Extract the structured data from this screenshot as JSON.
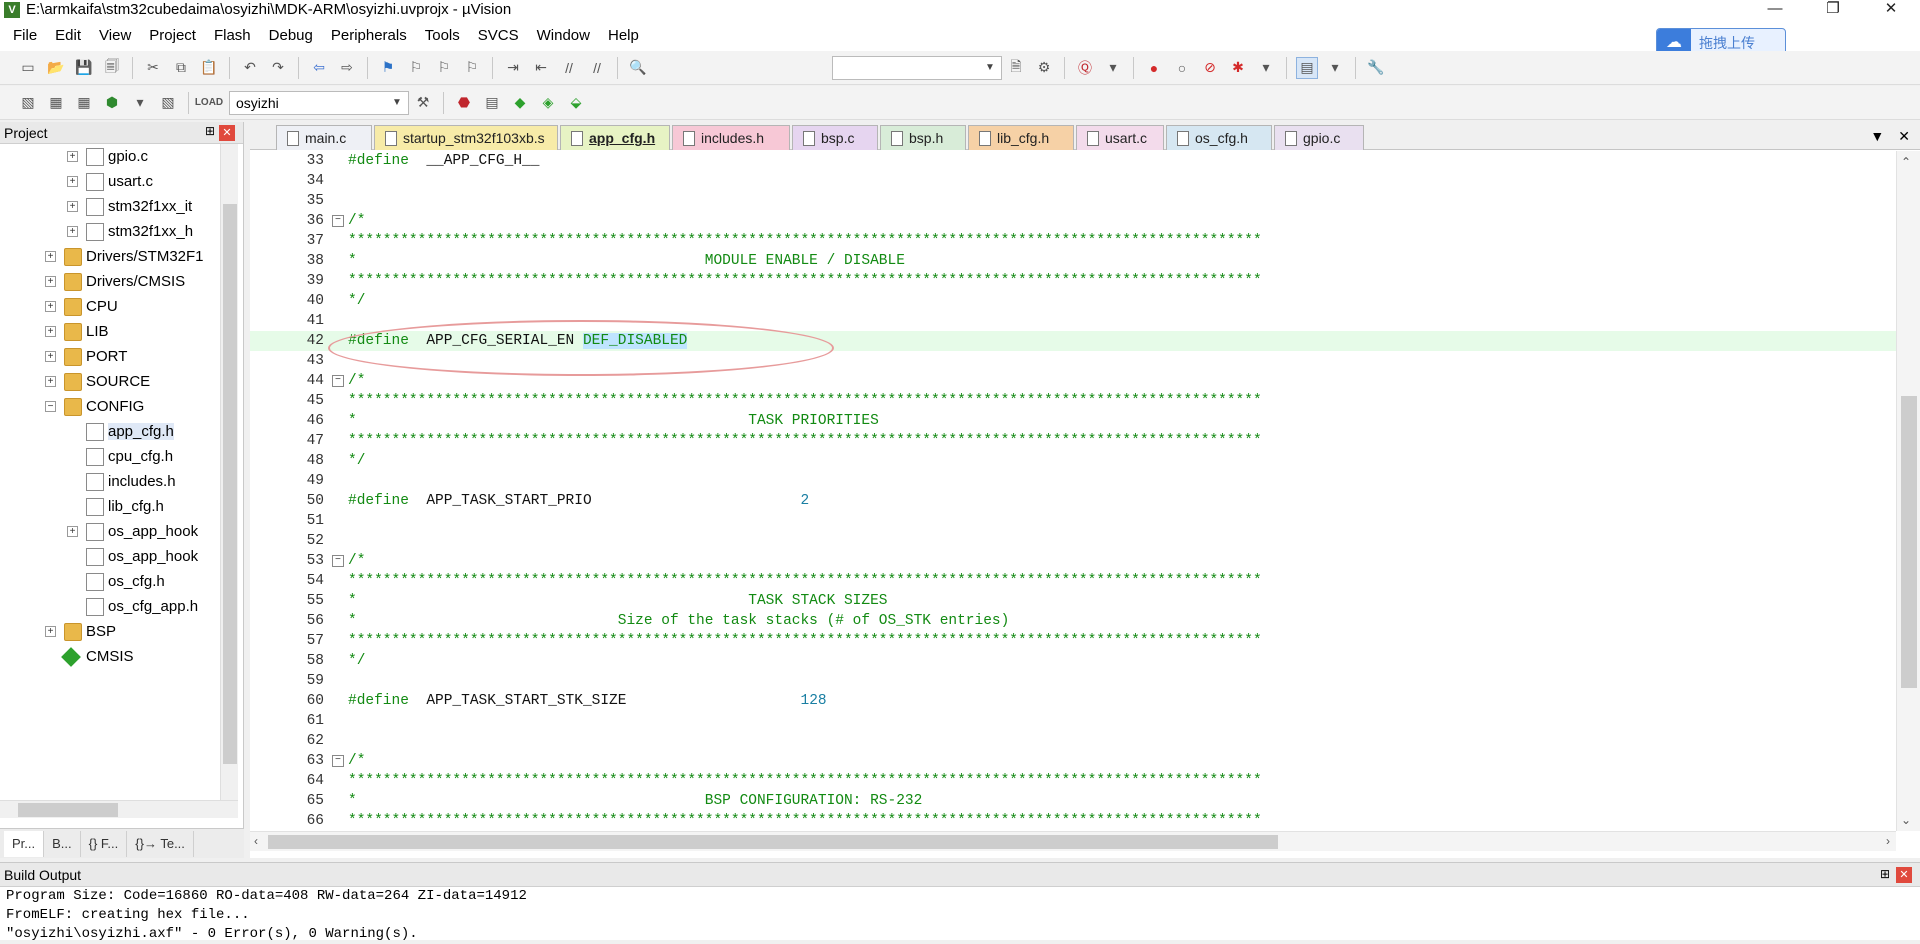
{
  "window": {
    "title": "E:\\armkaifa\\stm32cubedaima\\osyizhi\\MDK-ARM\\osyizhi.uvprojx - µVision",
    "icon_label": "V",
    "minimize": "—",
    "restore": "❐",
    "close": "✕"
  },
  "menu": [
    "File",
    "Edit",
    "View",
    "Project",
    "Flash",
    "Debug",
    "Peripherals",
    "Tools",
    "SVCS",
    "Window",
    "Help"
  ],
  "cloud_badge": {
    "label": "拖拽上传",
    "icon": "cloud-icon"
  },
  "toolbar2": {
    "target_combo": "osyizhi"
  },
  "project_panel": {
    "title": "Project",
    "pin": "⊞",
    "close": "✕",
    "tree": [
      {
        "label": "gpio.c",
        "type": "file",
        "level": 3,
        "expander": "+"
      },
      {
        "label": "usart.c",
        "type": "file",
        "level": 3,
        "expander": "+"
      },
      {
        "label": "stm32f1xx_it",
        "type": "file",
        "level": 3,
        "expander": "+"
      },
      {
        "label": "stm32f1xx_h",
        "type": "file",
        "level": 3,
        "expander": "+"
      },
      {
        "label": "Drivers/STM32F1",
        "type": "folder",
        "level": 2,
        "expander": "+"
      },
      {
        "label": "Drivers/CMSIS",
        "type": "folder",
        "level": 2,
        "expander": "+"
      },
      {
        "label": "CPU",
        "type": "folder",
        "level": 2,
        "expander": "+"
      },
      {
        "label": "LIB",
        "type": "folder",
        "level": 2,
        "expander": "+"
      },
      {
        "label": "PORT",
        "type": "folder",
        "level": 2,
        "expander": "+"
      },
      {
        "label": "SOURCE",
        "type": "folder",
        "level": 2,
        "expander": "+"
      },
      {
        "label": "CONFIG",
        "type": "folder-open",
        "level": 2,
        "expander": "−"
      },
      {
        "label": "app_cfg.h",
        "type": "file",
        "level": 3,
        "expander": "",
        "selected": true
      },
      {
        "label": "cpu_cfg.h",
        "type": "file",
        "level": 3,
        "expander": ""
      },
      {
        "label": "includes.h",
        "type": "file",
        "level": 3,
        "expander": ""
      },
      {
        "label": "lib_cfg.h",
        "type": "file",
        "level": 3,
        "expander": ""
      },
      {
        "label": "os_app_hook",
        "type": "file",
        "level": 3,
        "expander": "+"
      },
      {
        "label": "os_app_hook",
        "type": "file",
        "level": 3,
        "expander": ""
      },
      {
        "label": "os_cfg.h",
        "type": "file",
        "level": 3,
        "expander": ""
      },
      {
        "label": "os_cfg_app.h",
        "type": "file",
        "level": 3,
        "expander": ""
      },
      {
        "label": "BSP",
        "type": "folder",
        "level": 2,
        "expander": "+"
      },
      {
        "label": "CMSIS",
        "type": "diamond",
        "level": 2,
        "expander": ""
      }
    ],
    "bottom_tabs": [
      "Pr...",
      "B...",
      "{} F...",
      "{}→ Te..."
    ]
  },
  "editor": {
    "tabs": [
      {
        "label": "main.c",
        "color": "#eef0f5",
        "width": 96
      },
      {
        "label": "startup_stm32f103xb.s",
        "color": "#f7eba8",
        "width": 184
      },
      {
        "label": "app_cfg.h",
        "color": "#e7f3c4",
        "width": 110,
        "active": true
      },
      {
        "label": "includes.h",
        "color": "#f7c8d6",
        "width": 118
      },
      {
        "label": "bsp.c",
        "color": "#e6d5f0",
        "width": 86
      },
      {
        "label": "bsp.h",
        "color": "#d8ecd8",
        "width": 86
      },
      {
        "label": "lib_cfg.h",
        "color": "#f6d1a6",
        "width": 106
      },
      {
        "label": "usart.c",
        "color": "#f3dbeb",
        "width": 88
      },
      {
        "label": "os_cfg.h",
        "color": "#d6e7f2",
        "width": 106
      },
      {
        "label": "gpio.c",
        "color": "#e9e0f0",
        "width": 90
      }
    ],
    "tab_menu": "▼",
    "tab_close": "✕",
    "lines": [
      {
        "n": "33",
        "fold": "",
        "kw": "#define",
        "id": "  __APP_CFG_H__",
        "num": "",
        "rest": ""
      },
      {
        "n": "34",
        "fold": "",
        "kw": "",
        "id": "",
        "num": "",
        "rest": ""
      },
      {
        "n": "35",
        "fold": "",
        "kw": "",
        "id": "",
        "num": "",
        "rest": ""
      },
      {
        "n": "36",
        "fold": "−",
        "kw": "/*",
        "id": "",
        "num": "",
        "rest": ""
      },
      {
        "n": "37",
        "fold": "",
        "kw": "*********************************************************************************************************",
        "id": "",
        "num": "",
        "rest": ""
      },
      {
        "n": "38",
        "fold": "",
        "kw": "*                                        MODULE ENABLE / DISABLE",
        "id": "",
        "num": "",
        "rest": ""
      },
      {
        "n": "39",
        "fold": "",
        "kw": "*********************************************************************************************************",
        "id": "",
        "num": "",
        "rest": ""
      },
      {
        "n": "40",
        "fold": "",
        "kw": "*/",
        "id": "",
        "num": "",
        "rest": ""
      },
      {
        "n": "41",
        "fold": "",
        "kw": "",
        "id": "",
        "num": "",
        "rest": ""
      },
      {
        "n": "42",
        "fold": "",
        "kw": "#define",
        "id": "  APP_CFG_SERIAL_EN ",
        "num": "",
        "rest": "DEF_DISABLED",
        "hl": true
      },
      {
        "n": "43",
        "fold": "",
        "kw": "",
        "id": "",
        "num": "",
        "rest": ""
      },
      {
        "n": "44",
        "fold": "−",
        "kw": "/*",
        "id": "",
        "num": "",
        "rest": ""
      },
      {
        "n": "45",
        "fold": "",
        "kw": "*********************************************************************************************************",
        "id": "",
        "num": "",
        "rest": ""
      },
      {
        "n": "46",
        "fold": "",
        "kw": "*                                             TASK PRIORITIES",
        "id": "",
        "num": "",
        "rest": ""
      },
      {
        "n": "47",
        "fold": "",
        "kw": "*********************************************************************************************************",
        "id": "",
        "num": "",
        "rest": ""
      },
      {
        "n": "48",
        "fold": "",
        "kw": "*/",
        "id": "",
        "num": "",
        "rest": ""
      },
      {
        "n": "49",
        "fold": "",
        "kw": "",
        "id": "",
        "num": "",
        "rest": ""
      },
      {
        "n": "50",
        "fold": "",
        "kw": "#define",
        "id": "  APP_TASK_START_PRIO                        ",
        "num": "2",
        "rest": ""
      },
      {
        "n": "51",
        "fold": "",
        "kw": "",
        "id": "",
        "num": "",
        "rest": ""
      },
      {
        "n": "52",
        "fold": "",
        "kw": "",
        "id": "",
        "num": "",
        "rest": ""
      },
      {
        "n": "53",
        "fold": "−",
        "kw": "/*",
        "id": "",
        "num": "",
        "rest": ""
      },
      {
        "n": "54",
        "fold": "",
        "kw": "*********************************************************************************************************",
        "id": "",
        "num": "",
        "rest": ""
      },
      {
        "n": "55",
        "fold": "",
        "kw": "*                                             TASK STACK SIZES",
        "id": "",
        "num": "",
        "rest": ""
      },
      {
        "n": "56",
        "fold": "",
        "kw": "*                              Size of the task stacks (# of OS_STK entries)",
        "id": "",
        "num": "",
        "rest": ""
      },
      {
        "n": "57",
        "fold": "",
        "kw": "*********************************************************************************************************",
        "id": "",
        "num": "",
        "rest": ""
      },
      {
        "n": "58",
        "fold": "",
        "kw": "*/",
        "id": "",
        "num": "",
        "rest": ""
      },
      {
        "n": "59",
        "fold": "",
        "kw": "",
        "id": "",
        "num": "",
        "rest": ""
      },
      {
        "n": "60",
        "fold": "",
        "kw": "#define",
        "id": "  APP_TASK_START_STK_SIZE                    ",
        "num": "128",
        "rest": ""
      },
      {
        "n": "61",
        "fold": "",
        "kw": "",
        "id": "",
        "num": "",
        "rest": ""
      },
      {
        "n": "62",
        "fold": "",
        "kw": "",
        "id": "",
        "num": "",
        "rest": ""
      },
      {
        "n": "63",
        "fold": "−",
        "kw": "/*",
        "id": "",
        "num": "",
        "rest": ""
      },
      {
        "n": "64",
        "fold": "",
        "kw": "*********************************************************************************************************",
        "id": "",
        "num": "",
        "rest": ""
      },
      {
        "n": "65",
        "fold": "",
        "kw": "*                                        BSP CONFIGURATION: RS-232",
        "id": "",
        "num": "",
        "rest": ""
      },
      {
        "n": "66",
        "fold": "",
        "kw": "*********************************************************************************************************",
        "id": "",
        "num": "",
        "rest": ""
      }
    ]
  },
  "build_output": {
    "title": "Build Output",
    "pin": "⊞",
    "close": "✕",
    "lines": [
      "Program Size: Code=16860 RO-data=408 RW-data=264 ZI-data=14912",
      "FromELF: creating hex file...",
      "\"osyizhi\\osyizhi.axf\" - 0 Error(s), 0 Warning(s)."
    ]
  },
  "colors": {
    "keyword_green": "#128a12",
    "number_teal": "#1a7fa3",
    "highlight_line": "#e6fbe8",
    "annotation_ellipse": "#e79b9b"
  }
}
